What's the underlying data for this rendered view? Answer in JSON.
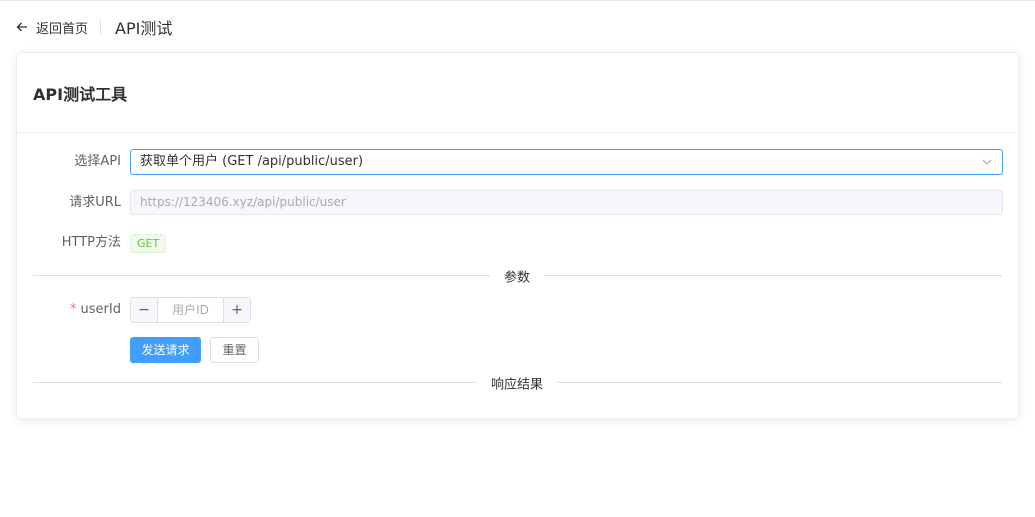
{
  "header": {
    "back_label": "返回首页",
    "page_title": "API测试"
  },
  "card": {
    "title": "API测试工具"
  },
  "form": {
    "api_label": "选择API",
    "api_selected": "获取单个用户 (GET /api/public/user)",
    "url_label": "请求URL",
    "url_value": "https://123406.xyz/api/public/user",
    "method_label": "HTTP方法",
    "method_value": "GET"
  },
  "params": {
    "section_title": "参数",
    "required_mark": "*",
    "userid_label": "userId",
    "userid_placeholder": "用户ID",
    "userid_value": "",
    "minus_label": "−",
    "plus_label": "+"
  },
  "actions": {
    "send_label": "发送请求",
    "reset_label": "重置"
  },
  "response": {
    "section_title": "响应结果"
  },
  "colors": {
    "primary": "#409eff",
    "success": "#67c23a",
    "danger": "#f56c6c"
  },
  "icons": {
    "back": "arrow-left-icon",
    "select": "chevron-down-icon"
  }
}
